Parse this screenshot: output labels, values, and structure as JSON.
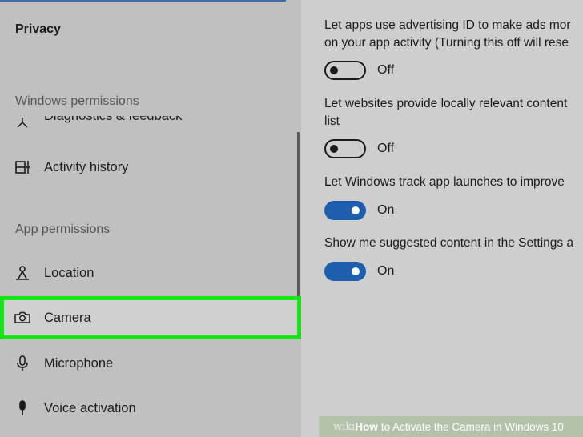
{
  "sidebar": {
    "title": "Privacy",
    "windows_permissions_header": "Windows permissions",
    "app_permissions_header": "App permissions",
    "items": [
      {
        "label": "Diagnostics & feedback",
        "icon": "diagnostics-icon"
      },
      {
        "label": "Activity history",
        "icon": "activity-history-icon"
      },
      {
        "label": "Location",
        "icon": "location-icon"
      },
      {
        "label": "Camera",
        "icon": "camera-icon",
        "selected": true
      },
      {
        "label": "Microphone",
        "icon": "microphone-icon"
      },
      {
        "label": "Voice activation",
        "icon": "voice-activation-icon"
      }
    ],
    "highlight_color": "#14e614"
  },
  "settings": [
    {
      "text": [
        "Let apps use advertising ID to make ads mor",
        "on your app activity (Turning this off will rese"
      ],
      "state": "Off"
    },
    {
      "text": [
        "Let websites provide locally relevant content",
        "list"
      ],
      "state": "Off"
    },
    {
      "text": [
        "Let Windows track app launches to improve"
      ],
      "state": "On"
    },
    {
      "text": [
        "Show me suggested content in the Settings a"
      ],
      "state": "On"
    }
  ],
  "colors": {
    "toggle_on": "#1d5fae",
    "accent": "#3d6ea8"
  },
  "watermark": {
    "brand": "wiki",
    "how": "How",
    "rest": "to Activate the Camera in Windows 10"
  }
}
